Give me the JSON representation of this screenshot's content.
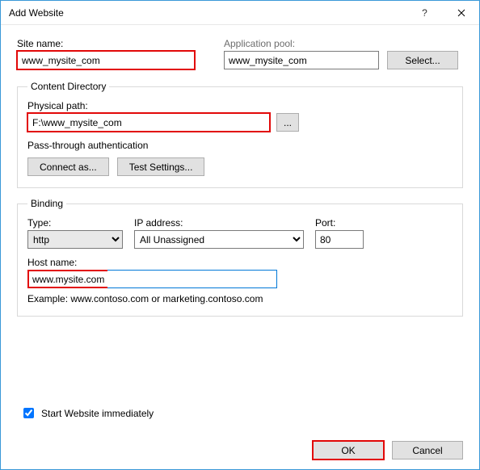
{
  "window": {
    "title": "Add Website",
    "help": "?",
    "close": "🗙"
  },
  "siteName": {
    "label": "Site name:",
    "value": "www_mysite_com"
  },
  "appPool": {
    "label": "Application pool:",
    "value": "www_mysite_com",
    "selectBtn": "Select..."
  },
  "contentDir": {
    "legend": "Content Directory",
    "physPathLabel": "Physical path:",
    "physPathValue": "F:\\www_mysite_com",
    "passThrough": "Pass-through authentication",
    "connectAs": "Connect as...",
    "testSettings": "Test Settings..."
  },
  "binding": {
    "legend": "Binding",
    "typeLabel": "Type:",
    "typeValue": "http",
    "ipLabel": "IP address:",
    "ipValue": "All Unassigned",
    "portLabel": "Port:",
    "portValue": "80",
    "hostLabel": "Host name:",
    "hostValue": "www.mysite.com",
    "example": "Example: www.contoso.com or marketing.contoso.com"
  },
  "startImmediately": {
    "label": "Start Website immediately",
    "checked": true
  },
  "buttons": {
    "ok": "OK",
    "cancel": "Cancel"
  }
}
